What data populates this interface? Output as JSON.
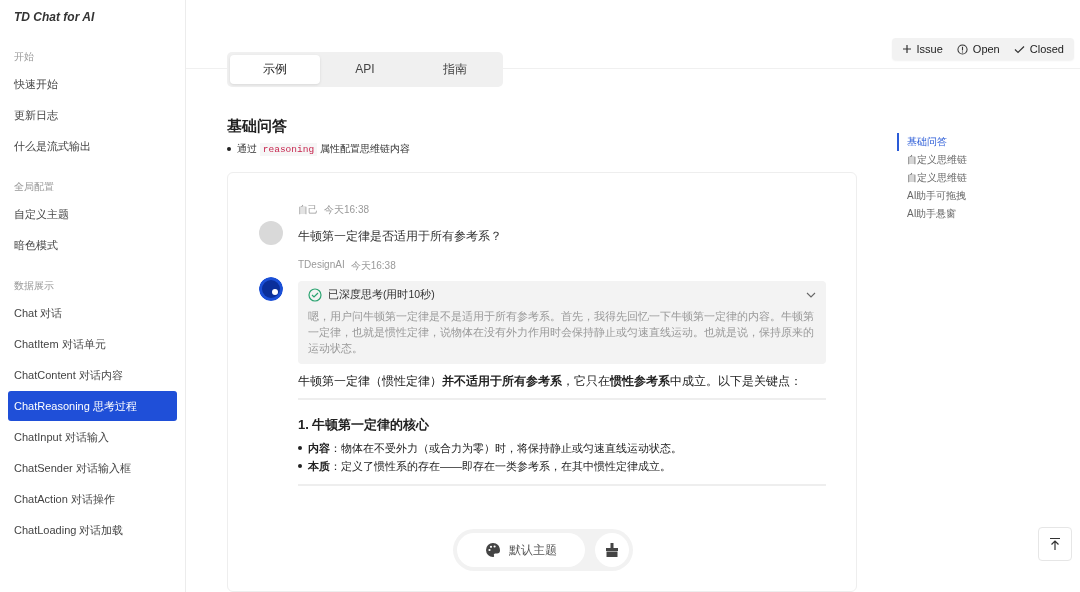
{
  "brand": "TD Chat for AI",
  "sidebar": {
    "groups": [
      {
        "title": "开始",
        "items": [
          {
            "label": "快速开始",
            "selected": false
          },
          {
            "label": "更新日志",
            "selected": false
          },
          {
            "label": "什么是流式输出",
            "selected": false
          }
        ]
      },
      {
        "title": "全局配置",
        "items": [
          {
            "label": "自定义主题",
            "selected": false
          },
          {
            "label": "暗色模式",
            "selected": false
          }
        ]
      },
      {
        "title": "数据展示",
        "items": [
          {
            "label": "Chat 对话",
            "selected": false
          },
          {
            "label": "ChatItem 对话单元",
            "selected": false
          },
          {
            "label": "ChatContent 对话内容",
            "selected": false
          },
          {
            "label": "ChatReasoning 思考过程",
            "selected": true
          },
          {
            "label": "ChatInput 对话输入",
            "selected": false
          },
          {
            "label": "ChatSender 对话输入框",
            "selected": false
          },
          {
            "label": "ChatAction 对话操作",
            "selected": false
          },
          {
            "label": "ChatLoading 对话加载",
            "selected": false
          }
        ]
      }
    ]
  },
  "header_actions": [
    {
      "kind": "add",
      "label": "Issue"
    },
    {
      "kind": "open",
      "label": "Open"
    },
    {
      "kind": "closed",
      "label": "Closed"
    }
  ],
  "tabs": [
    {
      "label": "示例",
      "selected": true
    },
    {
      "label": "API",
      "selected": false
    },
    {
      "label": "指南",
      "selected": false
    }
  ],
  "section": {
    "title": "基础问答",
    "bullet": {
      "before": "通过",
      "code": "reasoning",
      "after": "属性配置思维链内容"
    }
  },
  "toc": [
    {
      "label": "基础问答",
      "selected": true
    },
    {
      "label": "自定义思维链",
      "selected": false
    },
    {
      "label": "自定义思维链",
      "selected": false
    },
    {
      "label": "AI助手可拖拽",
      "selected": false
    },
    {
      "label": "AI助手悬窗",
      "selected": false
    }
  ],
  "chat": {
    "messages": [
      {
        "kind": "user",
        "name": "自己",
        "time": "今天16:38",
        "text": "牛顿第一定律是否适用于所有参考系？"
      },
      {
        "kind": "ai",
        "name": "TDesignAI",
        "time": "今天16:38",
        "reasoning": {
          "title": "已深度思考(用时10秒)",
          "expanded": true,
          "text": "嗯，用户问牛顿第一定律是不是适用于所有参考系。首先，我得先回忆一下牛顿第一定律的内容。牛顿第一定律，也就是惯性定律，说物体在没有外力作用时会保持静止或匀速直线运动。也就是说，保持原来的运动状态。"
        },
        "answer": {
          "intro": "牛顿第一定律（惯性定律）**并不适用于所有参考系**，它只在**惯性参考系**中成立。以下是关键点：",
          "heading": "1. 牛顿第一定律的核心",
          "bullets": [
            "**内容**：物体在不受外力（或合力为零）时，将保持静止或匀速直线运动状态。",
            "**本质**：定义了惯性系的存在——即存在一类参考系，在其中惯性定律成立。"
          ]
        }
      }
    ]
  },
  "toolbar": {
    "theme_button": "默认主题"
  }
}
